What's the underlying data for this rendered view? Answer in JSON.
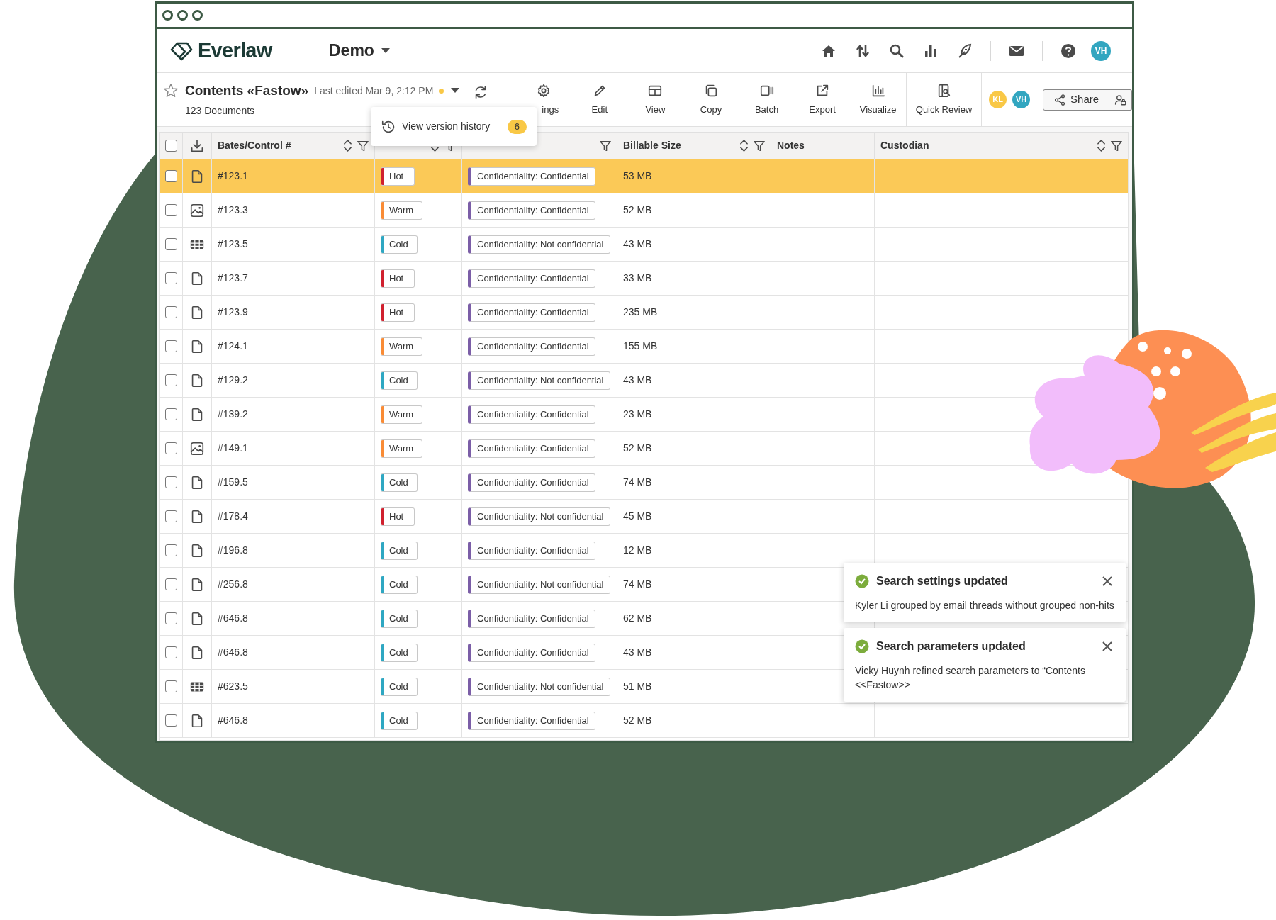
{
  "header": {
    "logo": "Everlaw",
    "project": "Demo",
    "user": "VH"
  },
  "toolbar": {
    "title": "Contents «Fastow»",
    "last_edited": "Last edited Mar 9, 2:12 PM",
    "unsaved": true,
    "count": "123 Documents",
    "buttons": [
      {
        "label": "ings"
      },
      {
        "label": "Edit"
      },
      {
        "label": "View"
      },
      {
        "label": "Copy"
      },
      {
        "label": "Batch"
      },
      {
        "label": "Export"
      },
      {
        "label": "Visualize"
      },
      {
        "label": "Quick Review"
      }
    ],
    "viewers": [
      {
        "initials": "KL",
        "color": "#f9c846"
      },
      {
        "initials": "VH",
        "color": "#32a6c0"
      }
    ],
    "share": "Share"
  },
  "version_popup": {
    "label": "View version history",
    "count": "6"
  },
  "table": {
    "columns": [
      {
        "kind": "check",
        "checked": false
      },
      {
        "kind": "download"
      },
      {
        "label": "Bates/Control #",
        "sort": true,
        "filter": true
      },
      {
        "sort": true,
        "filter": true
      },
      {
        "filter": true
      },
      {
        "label": "Billable Size",
        "sort": true,
        "filter": true
      },
      {
        "label": "Notes"
      },
      {
        "label": "Custodian",
        "sort": true,
        "filter": true
      }
    ],
    "rows": [
      {
        "checked": false,
        "selected": true,
        "kind": "document",
        "bates": "#123.1",
        "rating": "Hot",
        "color": "#d0202e",
        "codes": "Confidentiality: Confidential",
        "size": "53 MB"
      },
      {
        "checked": false,
        "selected": false,
        "kind": "image",
        "bates": "#123.3",
        "rating": "Warm",
        "color": "#f98b35",
        "codes": "Confidentiality: Confidential",
        "size": "52 MB"
      },
      {
        "checked": false,
        "selected": false,
        "kind": "spreadsheet",
        "bates": "#123.5",
        "rating": "Cold",
        "color": "#2ea7c2",
        "codes": "Confidentiality: Not confidential",
        "size": "43 MB"
      },
      {
        "checked": false,
        "selected": false,
        "kind": "document",
        "bates": "#123.7",
        "rating": "Hot",
        "color": "#d0202e",
        "codes": "Confidentiality: Confidential",
        "size": "33 MB"
      },
      {
        "checked": false,
        "selected": false,
        "kind": "document",
        "bates": "#123.9",
        "rating": "Hot",
        "color": "#d0202e",
        "codes": "Confidentiality: Confidential",
        "size": "235 MB"
      },
      {
        "checked": false,
        "selected": false,
        "kind": "document",
        "bates": "#124.1",
        "rating": "Warm",
        "color": "#f98b35",
        "codes": "Confidentiality: Confidential",
        "size": "155 MB"
      },
      {
        "checked": false,
        "selected": false,
        "kind": "document",
        "bates": "#129.2",
        "rating": "Cold",
        "color": "#2ea7c2",
        "codes": "Confidentiality: Not confidential",
        "size": "43 MB"
      },
      {
        "checked": false,
        "selected": false,
        "kind": "document",
        "bates": "#139.2",
        "rating": "Warm",
        "color": "#f98b35",
        "codes": "Confidentiality: Confidential",
        "size": "23 MB"
      },
      {
        "checked": false,
        "selected": false,
        "kind": "image",
        "bates": "#149.1",
        "rating": "Warm",
        "color": "#f98b35",
        "codes": "Confidentiality: Confidential",
        "size": "52 MB"
      },
      {
        "checked": false,
        "selected": false,
        "kind": "document",
        "bates": "#159.5",
        "rating": "Cold",
        "color": "#2ea7c2",
        "codes": "Confidentiality: Confidential",
        "size": "74 MB"
      },
      {
        "checked": false,
        "selected": false,
        "kind": "document",
        "bates": "#178.4",
        "rating": "Hot",
        "color": "#d0202e",
        "codes": "Confidentiality: Not confidential",
        "size": "45 MB"
      },
      {
        "checked": false,
        "selected": false,
        "kind": "document",
        "bates": "#196.8",
        "rating": "Cold",
        "color": "#2ea7c2",
        "codes": "Confidentiality: Confidential",
        "size": "12 MB"
      },
      {
        "checked": false,
        "selected": false,
        "kind": "document",
        "bates": "#256.8",
        "rating": "Cold",
        "color": "#2ea7c2",
        "codes": "Confidentiality: Not confidential",
        "size": "74 MB"
      },
      {
        "checked": false,
        "selected": false,
        "kind": "document",
        "bates": "#646.8",
        "rating": "Cold",
        "color": "#2ea7c2",
        "codes": "Confidentiality: Confidential",
        "size": "62 MB"
      },
      {
        "checked": false,
        "selected": false,
        "kind": "document",
        "bates": "#646.8",
        "rating": "Cold",
        "color": "#2ea7c2",
        "codes": "Confidentiality: Confidential",
        "size": "43 MB"
      },
      {
        "checked": false,
        "selected": false,
        "kind": "spreadsheet",
        "bates": "#623.5",
        "rating": "Cold",
        "color": "#2ea7c2",
        "codes": "Confidentiality: Not confidential",
        "size": "51 MB"
      },
      {
        "checked": false,
        "selected": false,
        "kind": "document",
        "bates": "#646.8",
        "rating": "Cold",
        "color": "#2ea7c2",
        "codes": "Confidentiality: Confidential",
        "size": "52 MB"
      }
    ]
  },
  "toasts": [
    {
      "title": "Search settings updated",
      "message": "Kyler Li grouped by email threads without grouped non-hits"
    },
    {
      "title": "Search parameters updated",
      "message": "Vicky Huynh refined search parameters to “Contents <<Fastow>>"
    }
  ]
}
